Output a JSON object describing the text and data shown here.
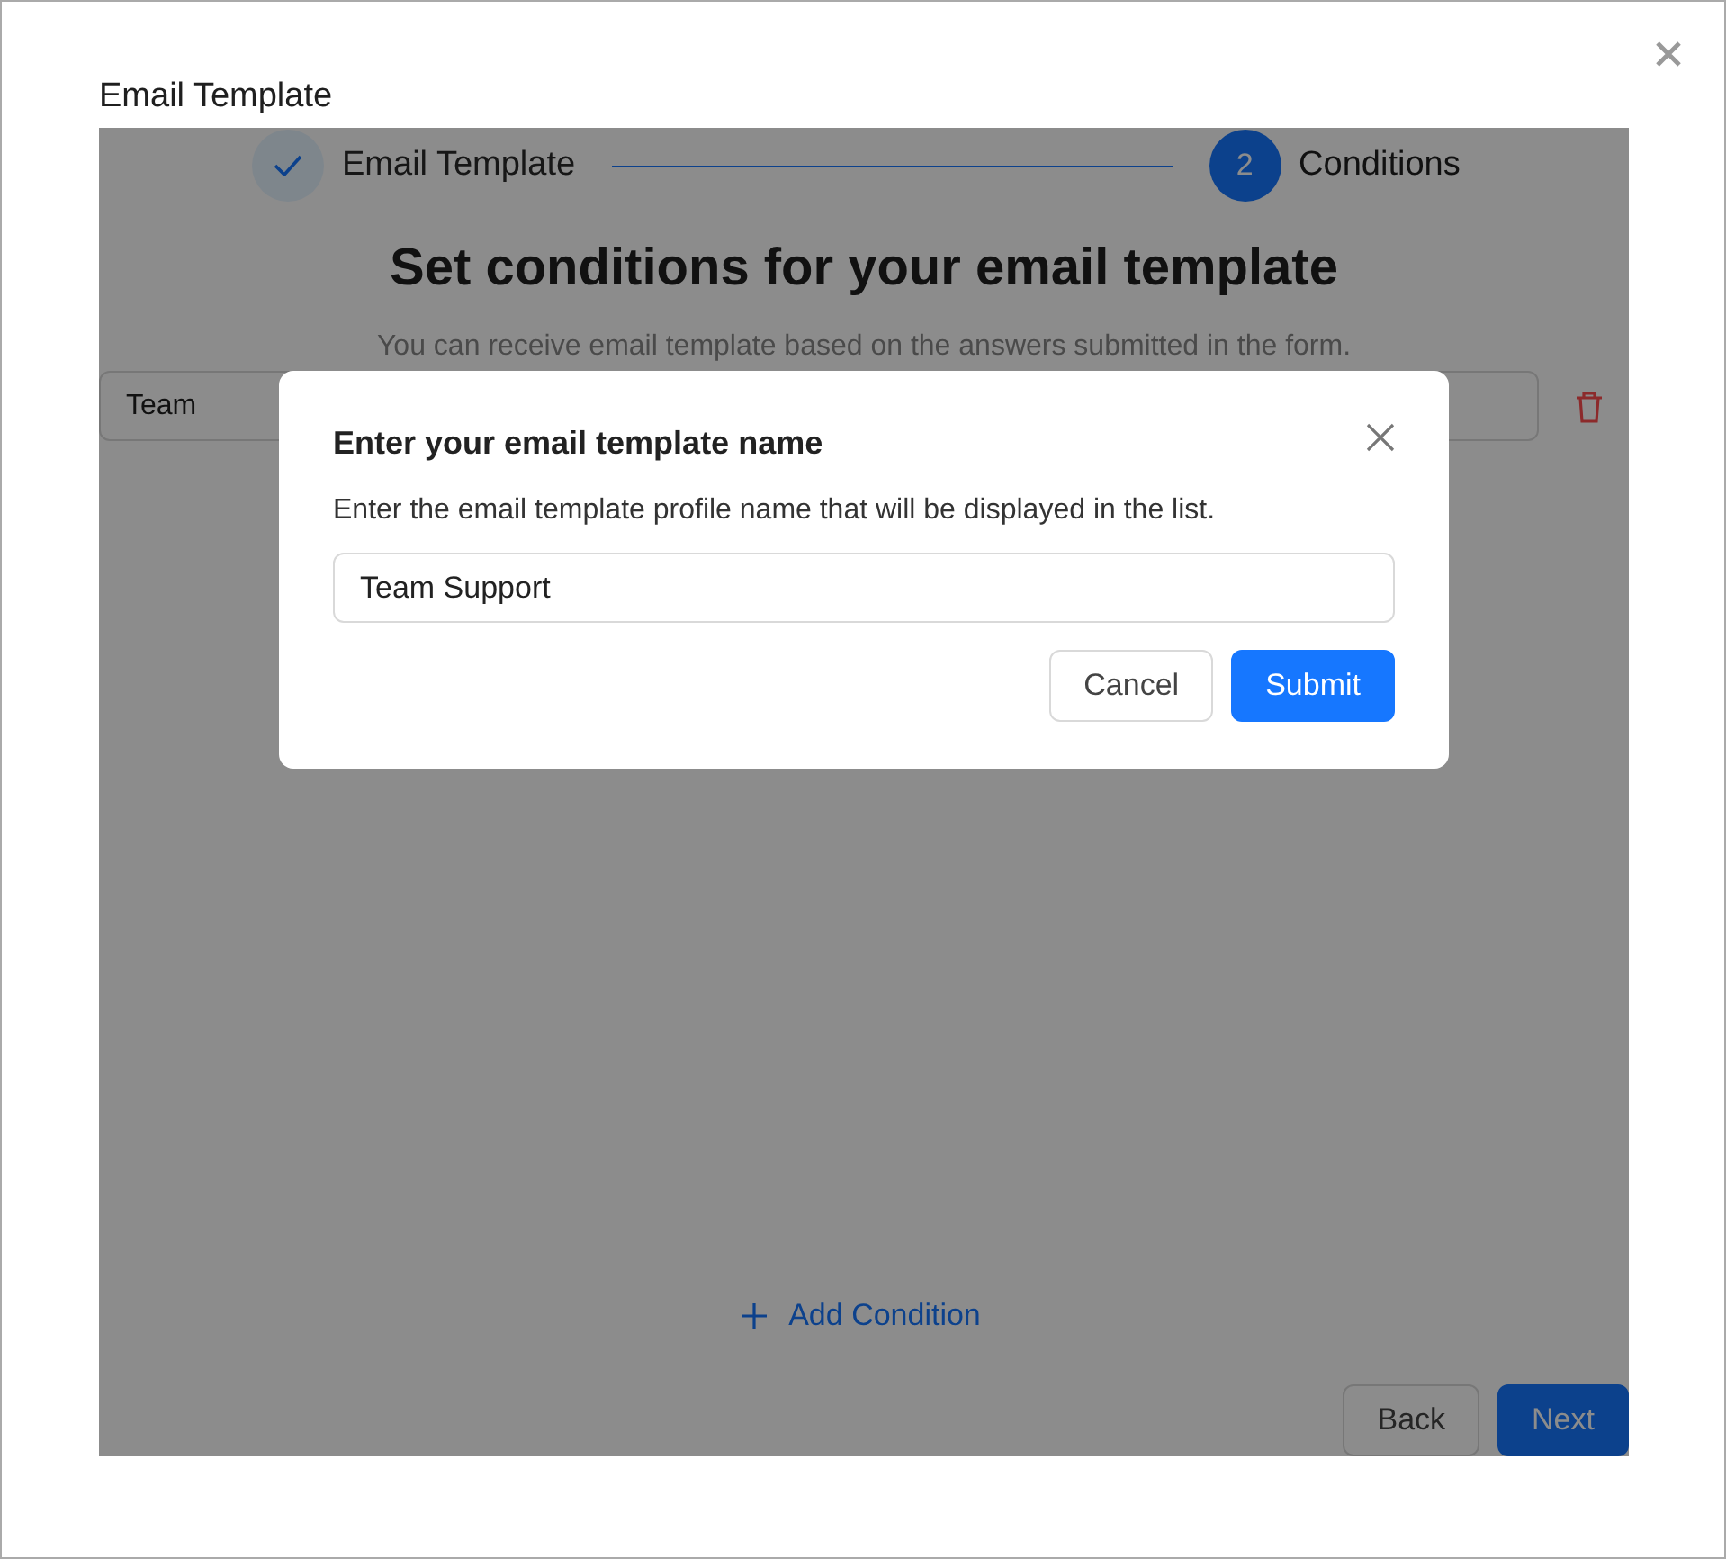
{
  "window": {
    "title": "Email Template"
  },
  "steps": [
    {
      "label": "Email Template",
      "completed": true,
      "current": false
    },
    {
      "label": "Conditions",
      "completed": false,
      "current": true,
      "number": "2"
    }
  ],
  "heading": "Set conditions for your email template",
  "subtitle": "You can receive email template based on the answers submitted in the form.",
  "conditions": [
    {
      "value": "Team"
    }
  ],
  "add_condition": "Add Condition",
  "footer_buttons": [
    {
      "label": "Back",
      "primary": false
    },
    {
      "label": "Next",
      "primary": true
    }
  ],
  "modal": {
    "title": "Enter your email template name",
    "description": "Enter the email template profile name that will be displayed in the list.",
    "field": {
      "value": "Team Support"
    },
    "buttons": [
      {
        "label": "Cancel",
        "primary": false
      },
      {
        "label": "Submit",
        "primary": true
      }
    ]
  }
}
